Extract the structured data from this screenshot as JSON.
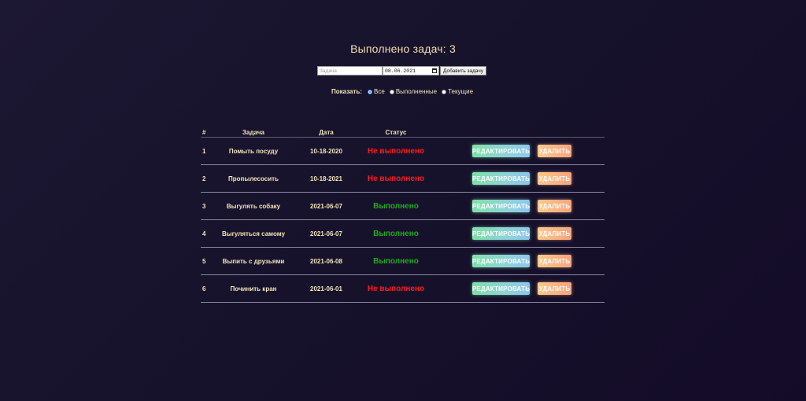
{
  "header": {
    "title": "Выполнено задач: 3"
  },
  "add_form": {
    "task_placeholder": "Задача",
    "date_value": "08.06.2021",
    "add_label": "Добавить задачу"
  },
  "filter": {
    "label": "Показать:",
    "options": [
      {
        "label": "Все",
        "checked": true
      },
      {
        "label": "Выполненные",
        "checked": false
      },
      {
        "label": "Текущие",
        "checked": false
      }
    ]
  },
  "table": {
    "columns": [
      "#",
      "Задача",
      "Дата",
      "Статус"
    ],
    "edit_label": "РЕДАКТИРОВАТЬ",
    "delete_label": "УДАЛИТЬ",
    "rows": [
      {
        "num": "1",
        "task": "Помыть посуду",
        "date": "10-18-2020",
        "status": "Не выполнено",
        "done": false
      },
      {
        "num": "2",
        "task": "Пропылесосить",
        "date": "10-18-2021",
        "status": "Не выполнено",
        "done": false
      },
      {
        "num": "3",
        "task": "Выгулять собаку",
        "date": "2021-06-07",
        "status": "Выполнено",
        "done": true
      },
      {
        "num": "4",
        "task": "Выгуляться самому",
        "date": "2021-06-07",
        "status": "Выполнено",
        "done": true
      },
      {
        "num": "5",
        "task": "Выпить с друзьями",
        "date": "2021-06-08",
        "status": "Выполнено",
        "done": true
      },
      {
        "num": "6",
        "task": "Починить кран",
        "date": "2021-06-01",
        "status": "Не выполнено",
        "done": false
      }
    ]
  },
  "colors": {
    "background": "#16122b",
    "text": "#f3e3b8",
    "status_fail": "#ff1a1a",
    "status_done": "#22a822"
  }
}
